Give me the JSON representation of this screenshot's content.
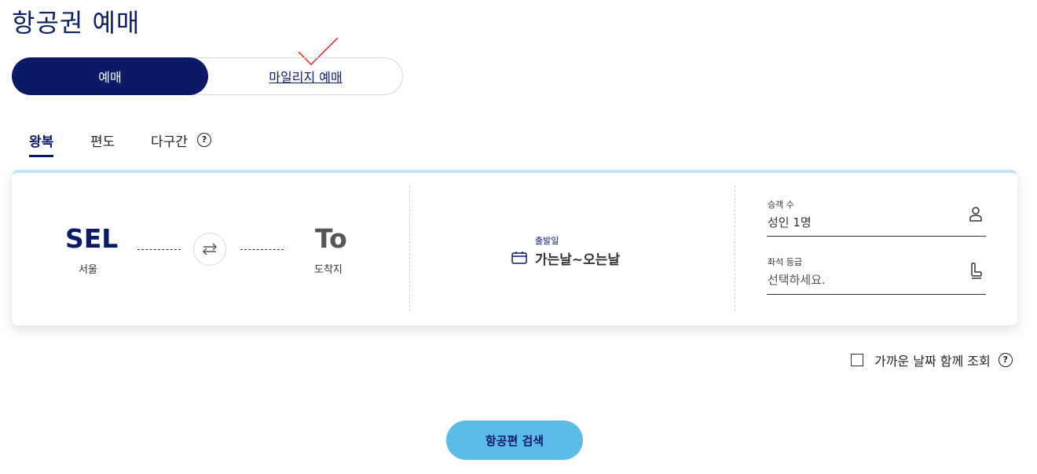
{
  "page": {
    "title": "항공권 예매"
  },
  "booking_toggle": {
    "active_label": "예매",
    "inactive_label": "마일리지 예매"
  },
  "trip_tabs": [
    {
      "label": "왕복",
      "active": true
    },
    {
      "label": "편도",
      "active": false
    },
    {
      "label": "다구간",
      "active": false
    }
  ],
  "route": {
    "from_code": "SEL",
    "from_city": "서울",
    "to_code": "To",
    "to_city": "도착지"
  },
  "date": {
    "label": "출발일",
    "value": "가는날~오는날"
  },
  "passengers": {
    "label": "승객 수",
    "value": "성인 1명"
  },
  "seat_class": {
    "label": "좌석 등급",
    "placeholder": "선택하세요."
  },
  "nearby_dates": {
    "label": "가까운 날짜 함께 조회",
    "checked": false
  },
  "search": {
    "label": "항공편 검색"
  },
  "help_glyph": "?",
  "colors": {
    "navy": "#0b1a66",
    "accent_blue": "#5bbbe9",
    "card_top_border": "#c3e6f5",
    "annotation_red": "#e02020"
  }
}
